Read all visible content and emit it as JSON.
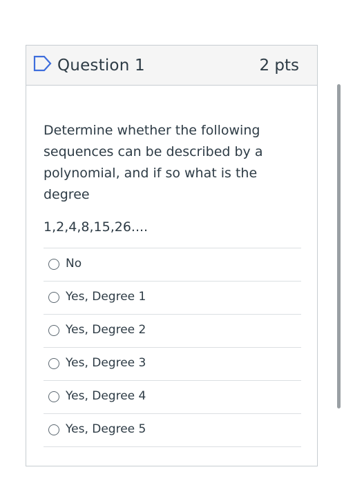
{
  "question": {
    "title": "Question 1",
    "points": "2 pts",
    "flag_icon": "flag-icon",
    "text": "Determine whether the following sequences can be described by a polynomial, and if so what is the degree",
    "sequence": "1,2,4,8,15,26...."
  },
  "answers": [
    {
      "label": "No",
      "selected": false
    },
    {
      "label": "Yes, Degree 1",
      "selected": false
    },
    {
      "label": "Yes, Degree 2",
      "selected": false
    },
    {
      "label": "Yes, Degree 3",
      "selected": false
    },
    {
      "label": "Yes, Degree 4",
      "selected": false
    },
    {
      "label": "Yes, Degree 5",
      "selected": false
    }
  ],
  "colors": {
    "text": "#2d3b45",
    "header_bg": "#f5f5f5",
    "border": "#c7cdd1",
    "flag": "#3d6ddc",
    "scrollbar": "#9aa0a4"
  }
}
